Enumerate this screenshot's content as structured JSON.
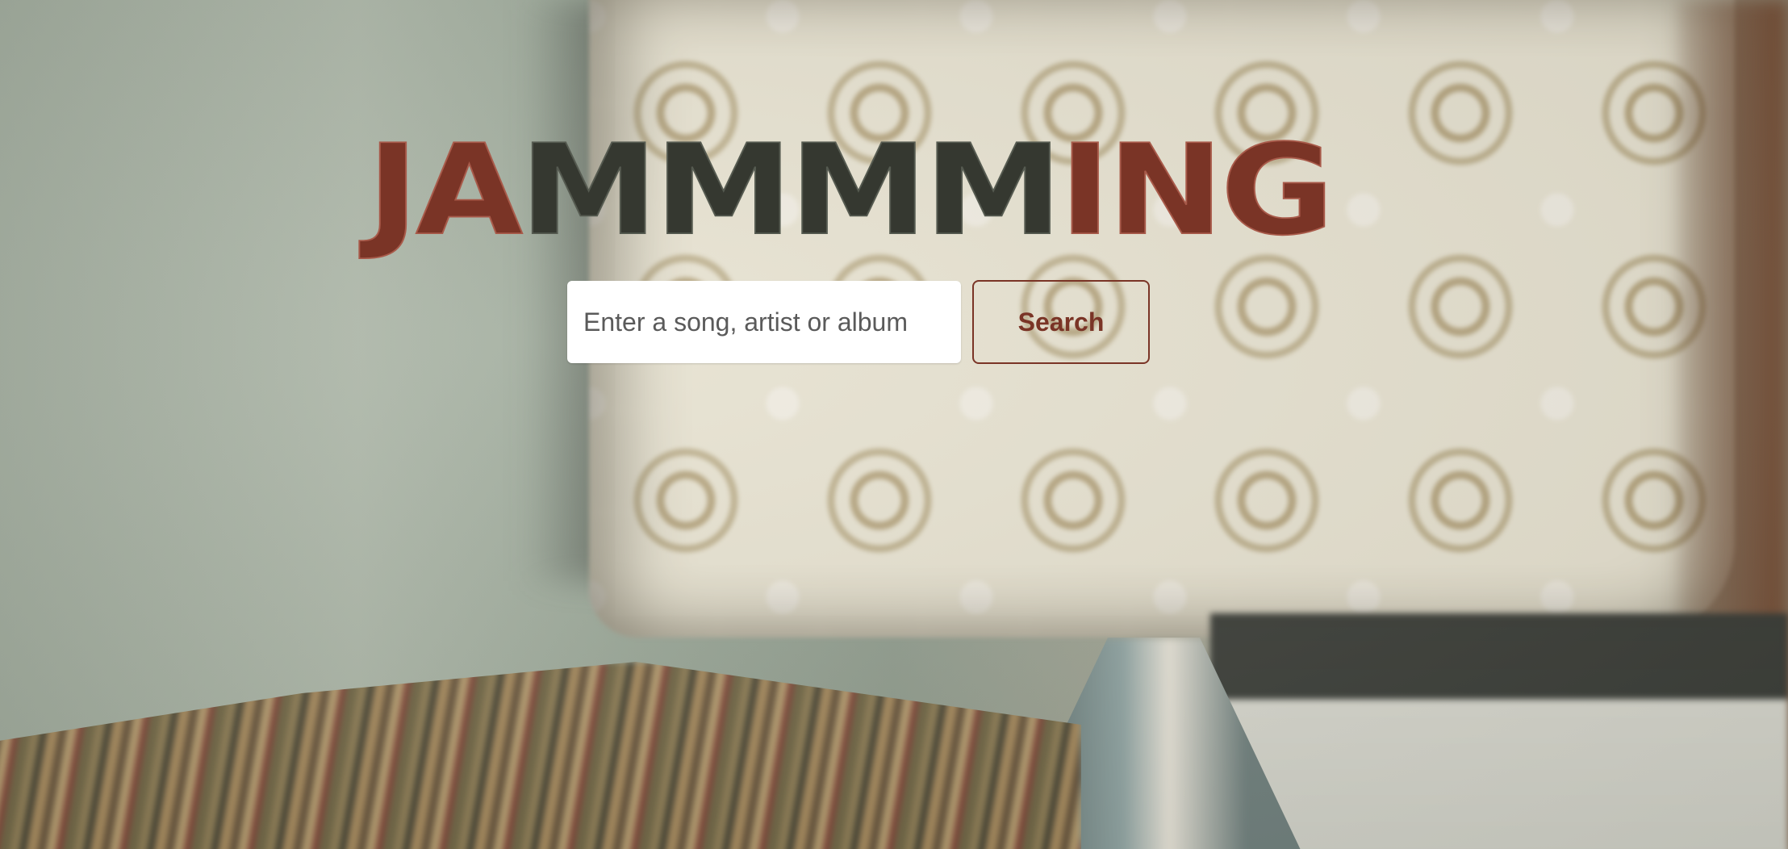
{
  "app": {
    "logo_text": "JAMMMMING",
    "logo_parts": {
      "start": "JA",
      "middle": "MMMM",
      "end": "ING"
    }
  },
  "search": {
    "placeholder": "Enter a song, artist or album",
    "value": "",
    "button_label": "Search"
  },
  "colors": {
    "accent": "#7a3426",
    "logo_dark": "#353830",
    "input_background": "#ffffff"
  }
}
